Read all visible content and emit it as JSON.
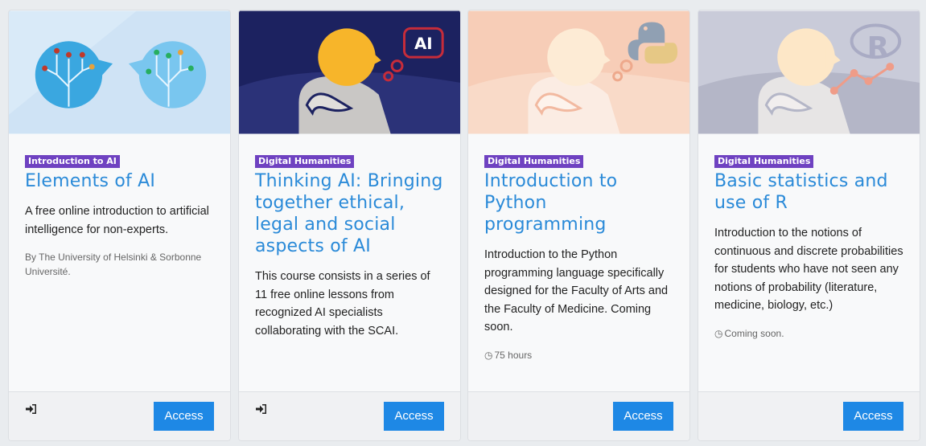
{
  "cards": [
    {
      "badge": "Introduction to AI",
      "title": "Elements of AI",
      "description": "A free online introduction to artificial intelligence for non-experts.",
      "meta": "By The University of Helsinki & Sorbonne Université.",
      "footer_icon": "sign-in-icon",
      "button": "Access"
    },
    {
      "badge": "Digital Humanities",
      "title": "Thinking AI: Bringing together ethical, legal and social aspects of AI",
      "description": "This course consists in a series of 11 free online lessons from recognized AI specialists collaborating with the SCAI.",
      "image_text": "AI",
      "footer_icon": "sign-in-icon",
      "button": "Access"
    },
    {
      "badge": "Digital Humanities",
      "title": "Introduction to Python programming",
      "description": "Introduction to the Python programming language specifically designed for the Faculty of Arts and the Faculty of Medicine. Coming soon.",
      "meta": "75 hours",
      "meta_icon": "clock-icon",
      "button": "Access"
    },
    {
      "badge": "Digital Humanities",
      "title": "Basic statistics and use of R",
      "description": "Introduction to the notions of continuous and discrete probabilities for students who have not seen any notions of probability (literature, medicine, biology, etc.)",
      "meta": "Coming soon.",
      "meta_icon": "clock-icon",
      "image_text": "R",
      "button": "Access"
    }
  ],
  "colors": {
    "badge": "#6f42c1",
    "title": "#2a8ad8",
    "button": "#1e88e5"
  }
}
